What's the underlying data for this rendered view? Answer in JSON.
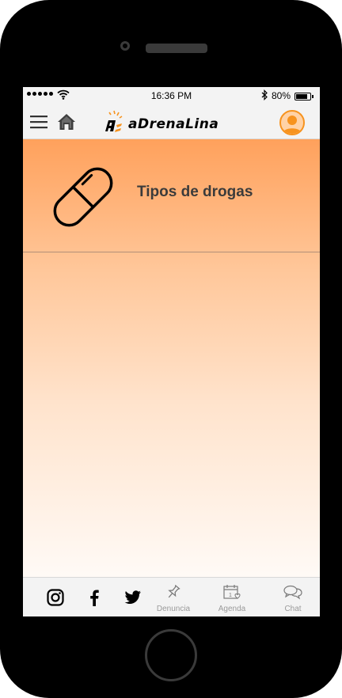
{
  "status_bar": {
    "time": "16:36 PM",
    "battery": "80%",
    "battery_level": 0.8
  },
  "header": {
    "logo_text": "aDrenaLina",
    "icons": {
      "menu": "hamburger-menu-icon",
      "home": "home-icon",
      "profile": "user-avatar-icon"
    }
  },
  "main": {
    "items": [
      {
        "label": "Tipos de drogas",
        "icon": "pill-capsule-icon"
      }
    ]
  },
  "bottom_nav": {
    "social": [
      "instagram-icon",
      "facebook-icon",
      "twitter-icon"
    ],
    "tabs": [
      {
        "label": "Denuncia",
        "icon": "pushpin-icon"
      },
      {
        "label": "Agenda",
        "icon": "calendar-heart-icon"
      },
      {
        "label": "Chat",
        "icon": "chat-bubbles-icon"
      }
    ]
  },
  "colors": {
    "accent": "#f7931e",
    "gradient_top": "#ffa15c",
    "gradient_bottom": "#fffaf6"
  }
}
